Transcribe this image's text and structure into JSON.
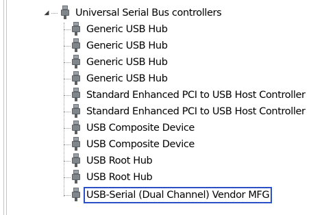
{
  "tree": {
    "root": {
      "label": "Universal Serial Bus controllers",
      "icon": "usb-connector-icon",
      "expanded": true
    },
    "children": [
      {
        "label": "Generic USB Hub",
        "icon": "usb-connector-icon"
      },
      {
        "label": "Generic USB Hub",
        "icon": "usb-connector-icon"
      },
      {
        "label": "Generic USB Hub",
        "icon": "usb-connector-icon"
      },
      {
        "label": "Generic USB Hub",
        "icon": "usb-connector-icon"
      },
      {
        "label": "Standard Enhanced PCI to USB Host Controller",
        "icon": "usb-connector-icon"
      },
      {
        "label": "Standard Enhanced PCI to USB Host Controller",
        "icon": "usb-connector-icon"
      },
      {
        "label": "USB Composite Device",
        "icon": "usb-connector-icon"
      },
      {
        "label": "USB Composite Device",
        "icon": "usb-connector-icon"
      },
      {
        "label": "USB Root Hub",
        "icon": "usb-connector-icon"
      },
      {
        "label": "USB Root Hub",
        "icon": "usb-connector-icon"
      },
      {
        "label": "USB-Serial (Dual Channel) Vendor MFG",
        "icon": "usb-connector-icon",
        "selected": true
      }
    ]
  },
  "colors": {
    "selection_border": "#2b4fc7",
    "tree_line": "#9a9a9a",
    "frame_line": "#c3c3c3"
  }
}
